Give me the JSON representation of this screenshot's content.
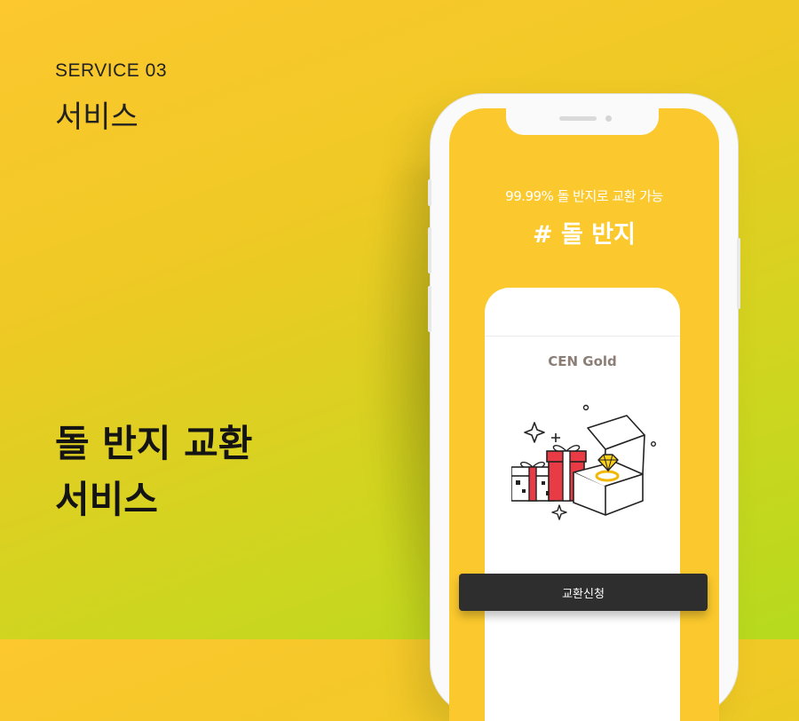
{
  "left": {
    "service_number": "SERVICE 03",
    "service_title": "서비스",
    "headline_line1": "돌 반지 교환",
    "headline_line2": "서비스"
  },
  "phone": {
    "tagline": "99.99% 돌 반지로 교환 가능",
    "hashtag": "# 돌 반지",
    "brand": "CEN Gold",
    "illustration_icon": "gift-ring-box-icon",
    "exchange_button_label": "교환신청"
  },
  "colors": {
    "background_top": "#fcc82e",
    "background_bottom": "#b6da1e",
    "screen": "#fbc92d",
    "button": "#2e2e2e",
    "brand_text": "#8c7e75"
  }
}
